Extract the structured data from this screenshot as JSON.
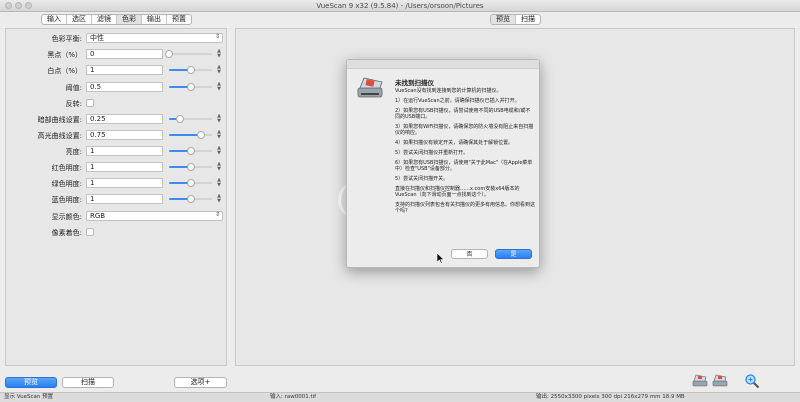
{
  "window": {
    "title": "VueScan 9 x32 (9.5.84) - /Users/orsoon/Pictures"
  },
  "left_tabs": [
    "输入",
    "选区",
    "滤镜",
    "色彩",
    "输出",
    "预置"
  ],
  "left_active_tab": 3,
  "right_tabs": [
    "预览",
    "扫描"
  ],
  "right_active_tab": 0,
  "color_panel": {
    "color_balance": {
      "label": "色彩平衡:",
      "value": "中性"
    },
    "black_point": {
      "label": "黑点（%）",
      "value": "0",
      "slider_fraction": 0.0
    },
    "white_point": {
      "label": "白点（%）",
      "value": "1",
      "slider_fraction": 0.5
    },
    "threshold": {
      "label": "阈值:",
      "value": "0.5",
      "slider_fraction": 0.5
    },
    "invert": {
      "label": "反转:",
      "checked": false
    },
    "shadow_curve": {
      "label": "暗部曲线设置:",
      "value": "0.25",
      "slider_fraction": 0.25
    },
    "highlight_curve": {
      "label": "高光曲线设置:",
      "value": "0.75",
      "slider_fraction": 0.75
    },
    "brightness": {
      "label": "亮度:",
      "value": "1",
      "slider_fraction": 0.5
    },
    "red_brightness": {
      "label": "红色明度:",
      "value": "1",
      "slider_fraction": 0.5
    },
    "green_brightness": {
      "label": "绿色明度:",
      "value": "1",
      "slider_fraction": 0.5
    },
    "blue_brightness": {
      "label": "蓝色明度:",
      "value": "1",
      "slider_fraction": 0.5
    },
    "display_color": {
      "label": "显示颜色:",
      "value": "RGB"
    },
    "pixel_colors": {
      "label": "像素着色:",
      "checked": false
    }
  },
  "dialog": {
    "title": "未找到扫描仪",
    "intro": "VueScan没有找到连接到您的计算机的扫描仪。",
    "items": [
      "1）在运行VueScan之前，请确保扫描仪已插入并打开。",
      "2）如果您有USB扫描仪，请尝试使用不同的USB电缆和/或不同的USB端口。",
      "3）如果您有WiFi扫描仪，请确保您的防火墙没有阻止来自扫描仪的响应。",
      "4）如果扫描仪有锁定开关，请确保其处于解锁位置。",
      "5）尝试关闭扫描仪并重新打开。",
      "6）如果您有USB扫描仪，请使用\"关于此Mac\"（在Apple菜单中）检查\"USB\"设备部分。",
      "5）尝试关闭扫描开关。"
    ],
    "footer1": "直接在扫描仪和扫描仪控制器……x.com安装x64版本的VueScan（向下滑动页面一点找到这个）。",
    "footer2": "支持的扫描仪列表包含有关扫描仪的更多有用信息。你想看到这个吗?",
    "btn_no": "否",
    "btn_yes": "是"
  },
  "bottom_buttons": {
    "preview": "预览",
    "scan": "扫描",
    "options": "选项+"
  },
  "status": {
    "left": "显示 VueScan 预置",
    "middle": "输入: raw0001.tif",
    "right": "输出: 2550x3300 pixels 300 dpi 216x279 mm 18.9 MB"
  },
  "icons": [
    "scanner-icon",
    "scanner-alt-icon",
    "zoom-icon"
  ],
  "colors": {
    "accent": "#2a7ff1",
    "slider_fill": "#3d8cf0"
  }
}
